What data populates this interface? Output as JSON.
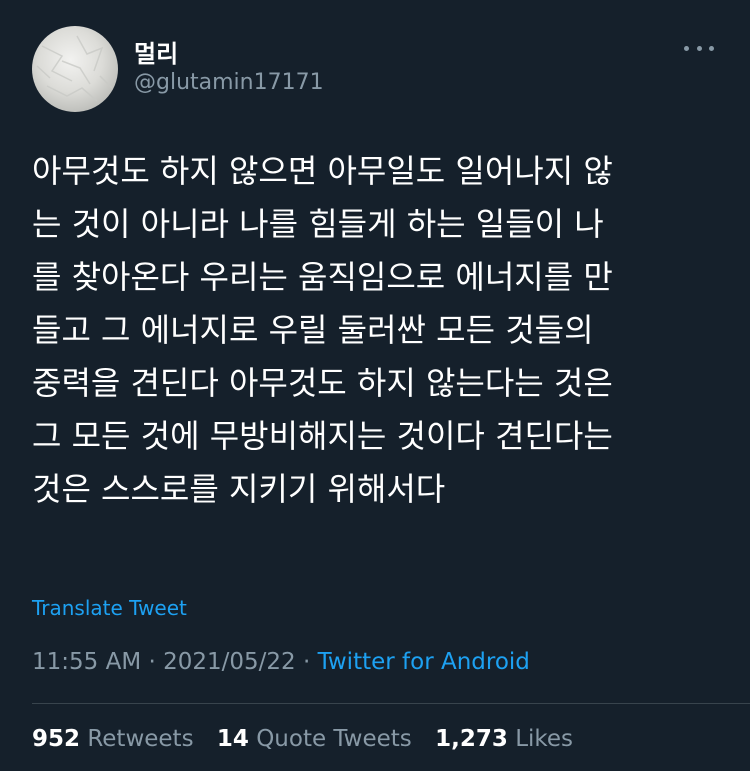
{
  "user": {
    "display_name": "멀리",
    "handle": "@glutamin17171"
  },
  "tweet": {
    "lines": [
      "아무것도 하지 않으면 아무일도 일어나지 않",
      "는 것이 아니라 나를 힘들게 하는 일들이 나",
      "를 찾아온다 우리는 움직임으로 에너지를 만",
      "들고 그 에너지로 우릴 둘러싼 모든 것들의",
      "중력을 견딘다 아무것도 하지 않는다는 것은",
      "그 모든 것에 무방비해지는 것이다 견딘다는",
      "것은 스스로를 지키기 위해서다"
    ],
    "translate_label": "Translate Tweet",
    "time": "11:55 AM",
    "date": "2021/05/22",
    "separator": "·",
    "source": "Twitter for Android"
  },
  "stats": {
    "retweets_count": "952",
    "retweets_label": "Retweets",
    "quotes_count": "14",
    "quotes_label": "Quote Tweets",
    "likes_count": "1,273",
    "likes_label": "Likes"
  },
  "colors": {
    "background": "#15202b",
    "accent": "#1da1f2",
    "secondary_text": "#8899a6"
  },
  "icons": {
    "more": "more-horizontal-icon"
  }
}
